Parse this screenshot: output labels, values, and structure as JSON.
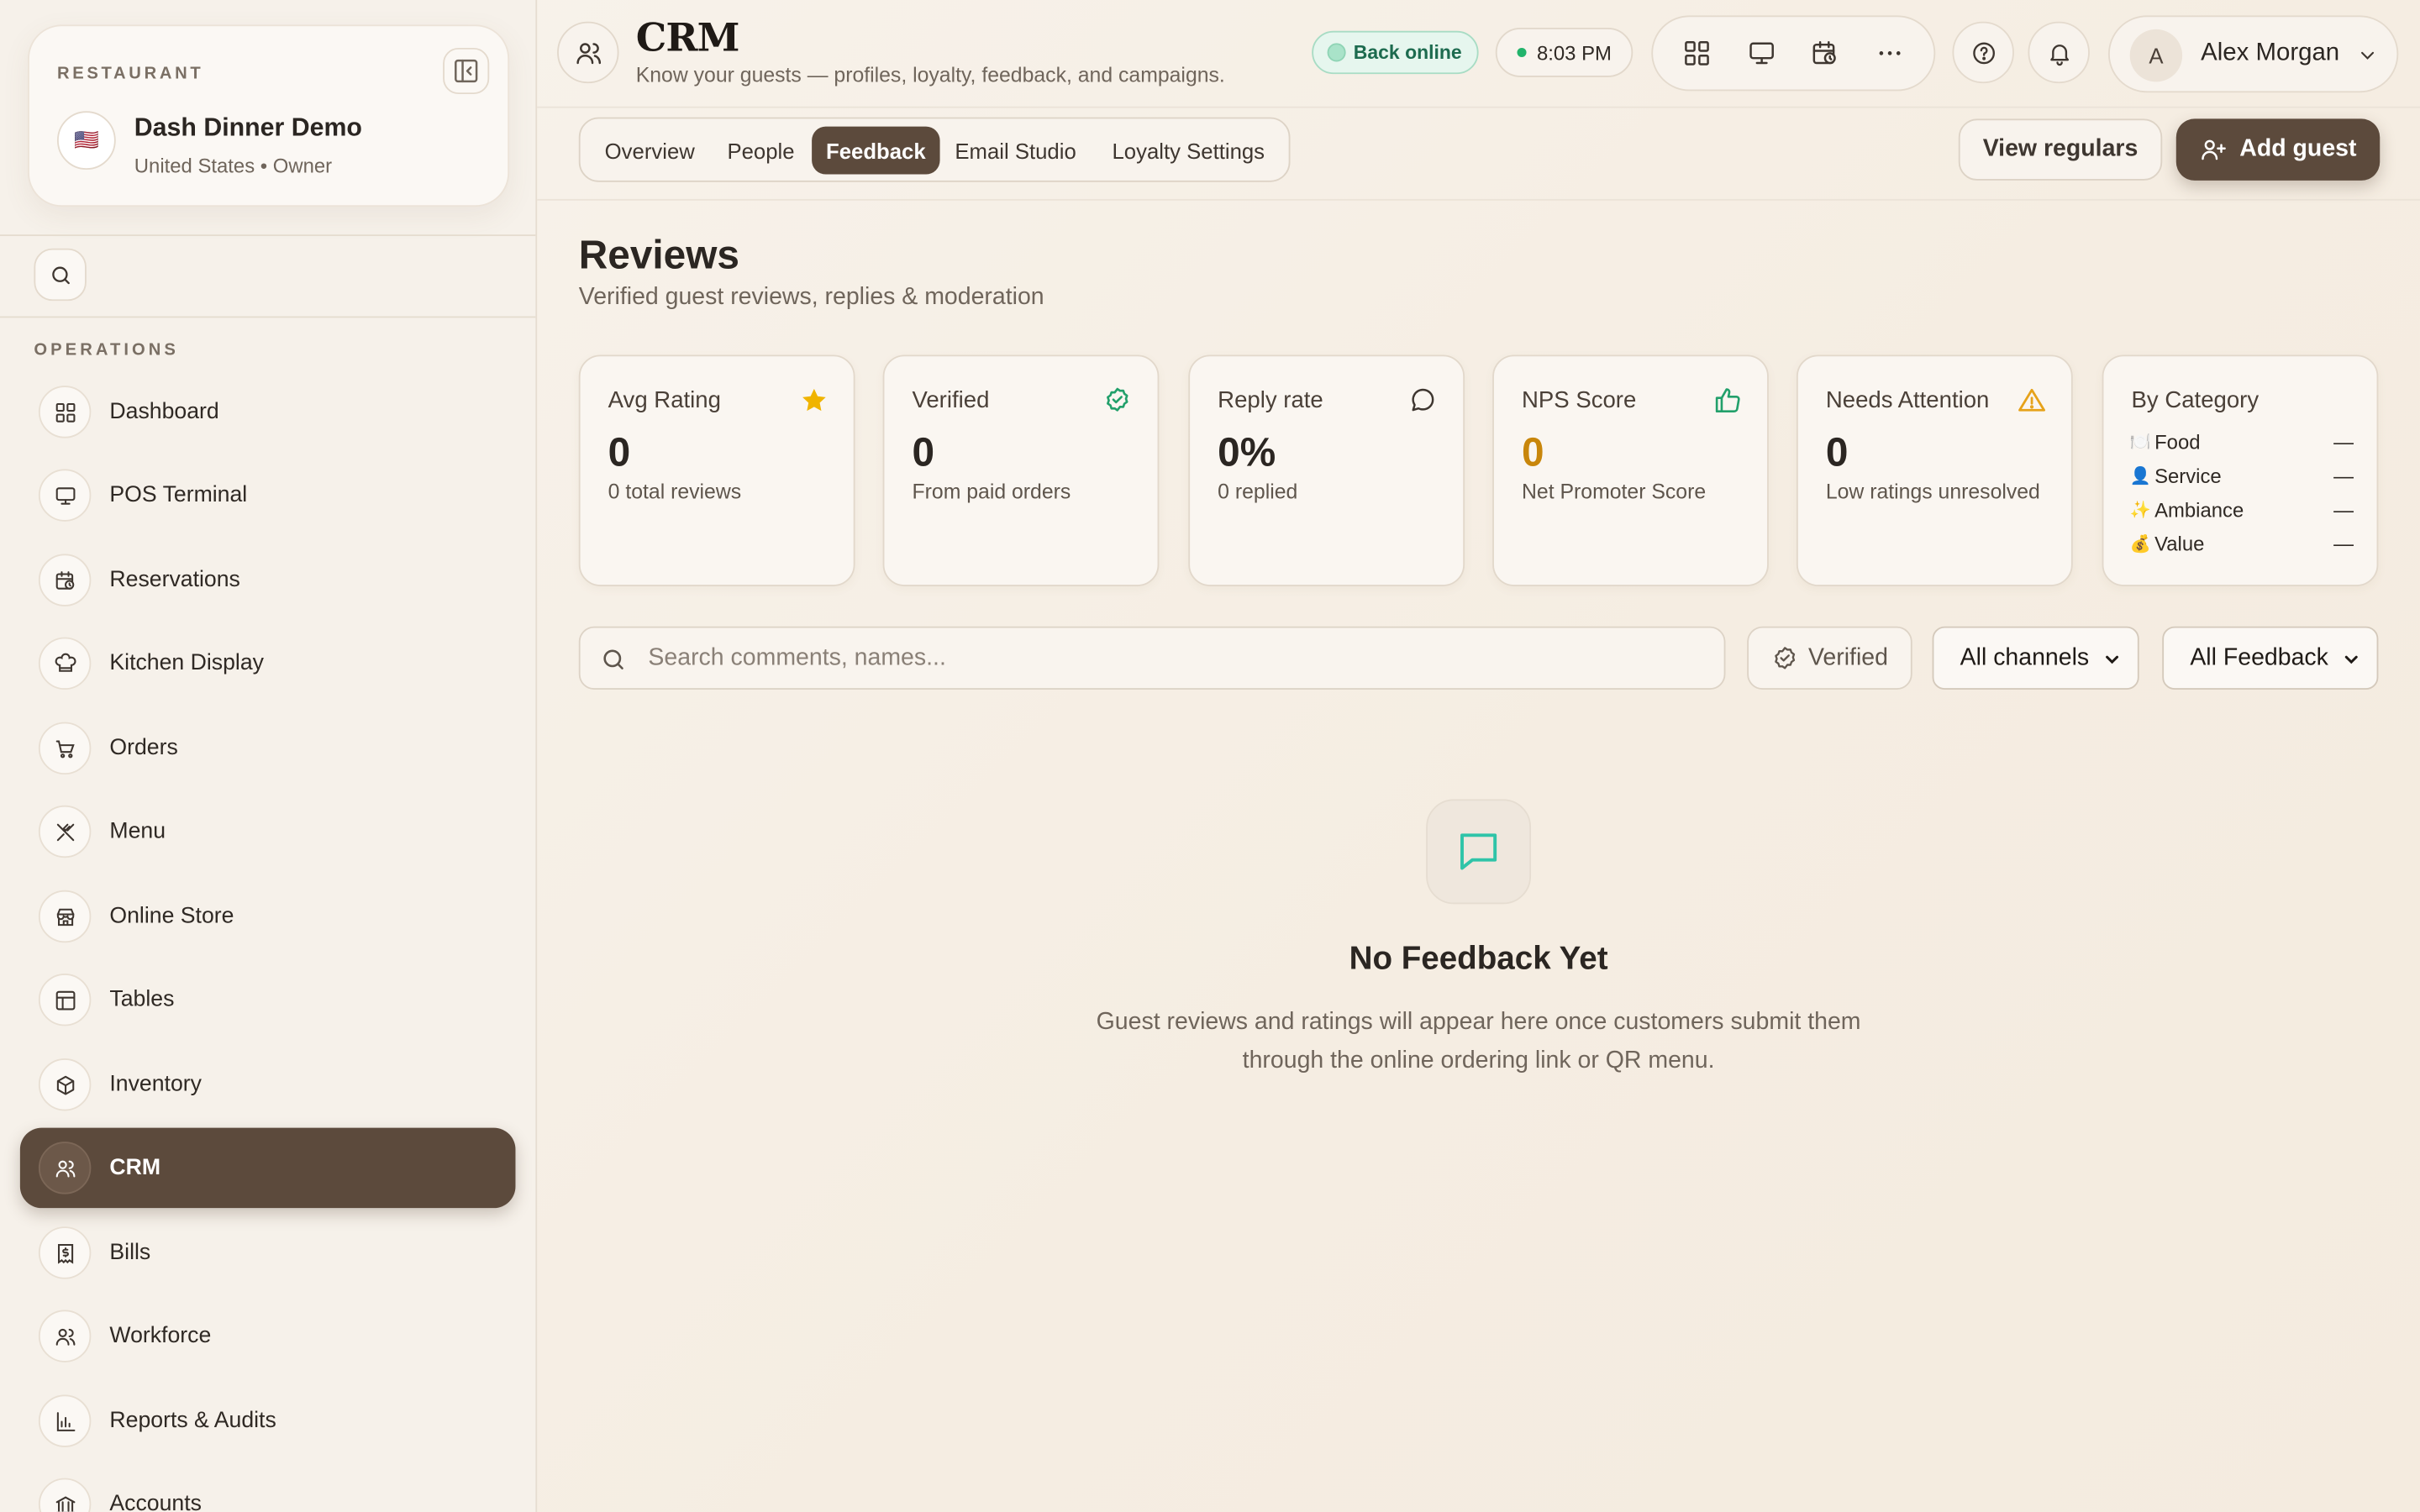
{
  "sidebar": {
    "restaurant_label": "RESTAURANT",
    "restaurant_name": "Dash Dinner Demo",
    "restaurant_sub": "United States • Owner",
    "flag": "🇺🇸",
    "section_label": "OPERATIONS",
    "items": [
      {
        "label": "Dashboard",
        "icon": "dashboard-icon"
      },
      {
        "label": "POS Terminal",
        "icon": "monitor-icon"
      },
      {
        "label": "Reservations",
        "icon": "calendar-clock-icon"
      },
      {
        "label": "Kitchen Display",
        "icon": "chef-hat-icon"
      },
      {
        "label": "Orders",
        "icon": "cart-icon"
      },
      {
        "label": "Menu",
        "icon": "utensils-icon"
      },
      {
        "label": "Online Store",
        "icon": "store-icon"
      },
      {
        "label": "Tables",
        "icon": "table-icon"
      },
      {
        "label": "Inventory",
        "icon": "box-icon"
      },
      {
        "label": "CRM",
        "icon": "users-icon",
        "active": true
      },
      {
        "label": "Bills",
        "icon": "receipt-icon"
      },
      {
        "label": "Workforce",
        "icon": "users-icon"
      },
      {
        "label": "Reports & Audits",
        "icon": "bar-chart-icon"
      },
      {
        "label": "Accounts",
        "icon": "bank-icon"
      }
    ]
  },
  "header": {
    "title": "CRM",
    "subtitle": "Know your guests — profiles, loyalty, feedback, and campaigns.",
    "status": "Back online",
    "time": "8:03 PM",
    "user_initial": "A",
    "user_name": "Alex Morgan"
  },
  "tabs": [
    {
      "label": "Overview"
    },
    {
      "label": "People"
    },
    {
      "label": "Feedback",
      "active": true
    },
    {
      "label": "Email Studio"
    },
    {
      "label": "Loyalty Settings"
    }
  ],
  "actions": {
    "view_regulars": "View regulars",
    "add_guest": "Add guest"
  },
  "reviews": {
    "title": "Reviews",
    "subtitle": "Verified guest reviews, replies & moderation",
    "stats": [
      {
        "label": "Avg Rating",
        "value": "0",
        "sub": "0 total reviews",
        "icon": "star-icon",
        "color": "#f0b400"
      },
      {
        "label": "Verified",
        "value": "0",
        "sub": "From paid orders",
        "icon": "badge-check-icon",
        "color": "#22a06b"
      },
      {
        "label": "Reply rate",
        "value": "0%",
        "sub": "0 replied",
        "icon": "message-circle-icon",
        "color": "#4a4038"
      },
      {
        "label": "NPS Score",
        "value": "0",
        "sub": "Net Promoter Score",
        "icon": "thumbs-up-icon",
        "color": "#22a06b"
      },
      {
        "label": "Needs Attention",
        "value": "0",
        "sub": "Low ratings unresolved",
        "icon": "alert-triangle-icon",
        "color": "#e6a21a"
      }
    ],
    "category": {
      "label": "By Category",
      "rows": [
        {
          "icon": "🍽️",
          "name": "Food",
          "value": "—"
        },
        {
          "icon": "👤",
          "name": "Service",
          "value": "—"
        },
        {
          "icon": "✨",
          "name": "Ambiance",
          "value": "—"
        },
        {
          "icon": "💰",
          "name": "Value",
          "value": "—"
        }
      ]
    }
  },
  "filters": {
    "search_placeholder": "Search comments, names...",
    "verified": "Verified",
    "channels": "All channels",
    "feedback": "All Feedback"
  },
  "empty": {
    "title": "No Feedback Yet",
    "text": "Guest reviews and ratings will appear here once customers submit them through the online ordering link or QR menu."
  },
  "colors": {
    "accent": "#5c4a3c",
    "online": "#1d6b4f",
    "amber": "#c8860b",
    "teal": "#2fc4a8"
  }
}
